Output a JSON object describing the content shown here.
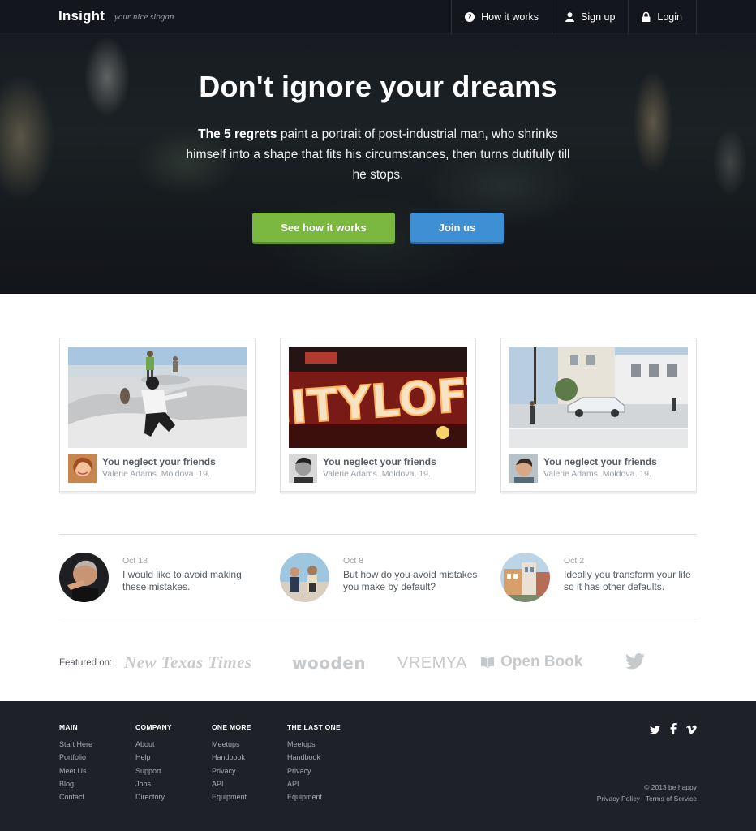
{
  "header": {
    "brand": "Insight",
    "slogan": "your nice slogan",
    "nav": [
      {
        "label": "How it works",
        "icon": "question-circle-icon"
      },
      {
        "label": "Sign up",
        "icon": "user-icon"
      },
      {
        "label": "Login",
        "icon": "lock-icon"
      }
    ]
  },
  "hero": {
    "title": "Don't ignore your dreams",
    "text_bold": "The 5 regrets",
    "text_rest": " paint a portrait of post-industrial man, who shrinks himself into a shape that fits his circumstances, then turns dutifully till he stops.",
    "primary_button": "See how it works",
    "secondary_button": "Join us"
  },
  "cards": [
    {
      "title": "You neglect your friends",
      "meta": "Valerie Adams. Moldova. 19."
    },
    {
      "title": "You neglect your friends",
      "meta": "Valerie Adams. Moldova. 19."
    },
    {
      "title": "You neglect your friends",
      "meta": "Valerie Adams. Moldova. 19."
    }
  ],
  "quotes": [
    {
      "date": "Oct 18",
      "text": "I would like to avoid making these mistakes."
    },
    {
      "date": "Oct 8",
      "text": "But how do you avoid mistakes you make by default?"
    },
    {
      "date": "Oct 2",
      "text": "Ideally you transform your life so it has other defaults."
    }
  ],
  "featured": {
    "label": "Featured on:",
    "logos": [
      "New Texas Times",
      "wooden",
      "VREMYA",
      "Open Book",
      "twitter-bird-icon"
    ]
  },
  "footer": {
    "columns": [
      {
        "heading": "MAIN",
        "links": [
          "Start Here",
          "Portfolio",
          "Meet Us",
          "Blog",
          "Contact"
        ]
      },
      {
        "heading": "COMPANY",
        "links": [
          "About",
          "Help",
          "Support",
          "Jobs",
          "Directory"
        ]
      },
      {
        "heading": "ONE MORE",
        "links": [
          "Meetups",
          "Handbook",
          "Privacy",
          "API",
          "Equipment"
        ]
      },
      {
        "heading": "THE LAST ONE",
        "links": [
          "Meetups",
          "Handbook",
          "Privacy",
          "API",
          "Equipment"
        ]
      }
    ],
    "social": [
      "twitter-icon",
      "facebook-icon",
      "vimeo-icon"
    ],
    "copyright": "© 2013 be happy",
    "legal": [
      "Privacy Policy",
      "Terms of Service"
    ]
  },
  "colors": {
    "green_button": "#7bb83f",
    "blue_button": "#3f8fd4",
    "footer_bg": "#1e2127"
  }
}
